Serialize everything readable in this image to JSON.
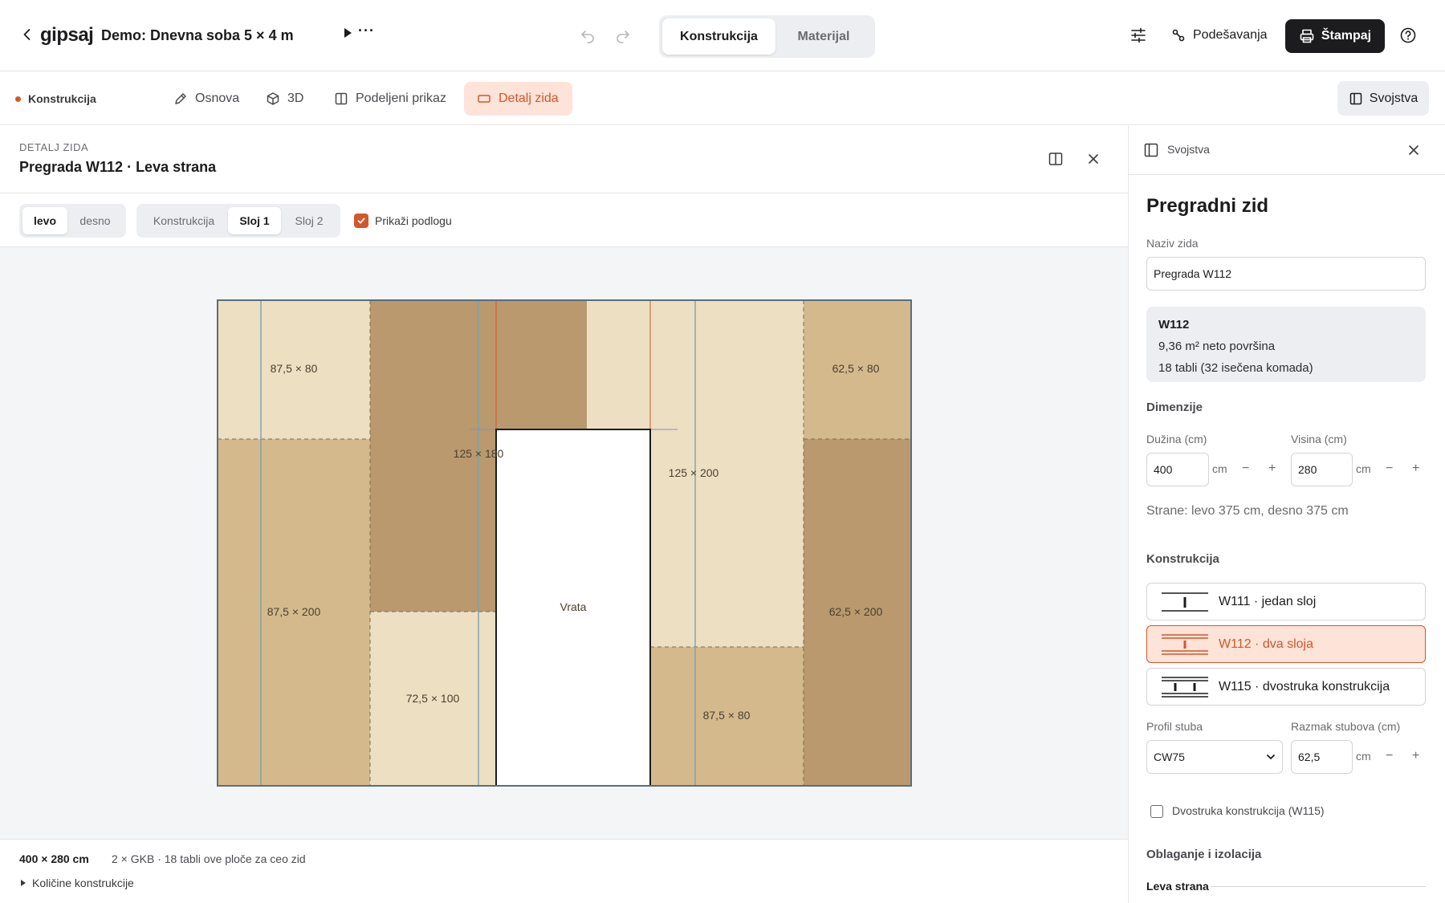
{
  "app": {
    "logo": "gipsaj",
    "project_title": "Demo: Dnevna soba 5 × 4 m",
    "more": "···"
  },
  "modes": [
    {
      "label": "Konstrukcija",
      "active": true
    },
    {
      "label": "Materijal",
      "active": false
    }
  ],
  "header_actions": {
    "settings_label": "Podešavanja",
    "print_label": "Štampaj"
  },
  "subbar": {
    "crumb": "Konstrukcija",
    "tabs": [
      {
        "label": "Osnova",
        "icon": "pen-icon"
      },
      {
        "label": "3D",
        "icon": "cube-icon"
      },
      {
        "label": "Podeljeni prikaz",
        "icon": "split-icon"
      },
      {
        "label": "Detalj zida",
        "icon": "wall-icon",
        "active": true
      }
    ],
    "properties_button": "Svojstva"
  },
  "detail": {
    "kicker": "DETALJ ZIDA",
    "title": "Pregrada W112 · Leva strana",
    "side_toggle": [
      {
        "label": "levo",
        "active": true
      },
      {
        "label": "desno",
        "active": false
      }
    ],
    "layer_toggle": [
      {
        "label": "Konstrukcija",
        "active": false
      },
      {
        "label": "Sloj 1",
        "active": true
      },
      {
        "label": "Sloj 2",
        "active": false
      }
    ],
    "show_base_label": "Prikaži podlogu",
    "show_base_checked": true
  },
  "wall": {
    "panels": [
      {
        "label": "87,5 × 80"
      },
      {
        "label": "87,5 × 200"
      },
      {
        "label": "125 × 180"
      },
      {
        "label": "72,5 × 100"
      },
      {
        "label": "125 × 200"
      },
      {
        "label": "87,5 × 80"
      },
      {
        "label": "62,5 × 80"
      },
      {
        "label": "62,5 × 200"
      }
    ],
    "door_label": "Vrata",
    "colors": {
      "light": "#ecdfc2",
      "mid": "#d4b98c",
      "dark": "#b9996d",
      "stud": "#7aa2b4",
      "outline": "#5b6e7a"
    }
  },
  "footer": {
    "dims": "400 × 280 cm",
    "spec": "2 × GKB · 18 tabli ove ploče za ceo zid",
    "quantities_label": "Količine konstrukcije"
  },
  "properties": {
    "header": "Svojstva",
    "title": "Pregradni zid",
    "name_label": "Naziv zida",
    "name_value": "Pregrada W112",
    "info": {
      "code": "W112",
      "area": "9,36 m² neto površina",
      "boards": "18 tabli (32 isečena komada)"
    },
    "dimensions_title": "Dimenzije",
    "length_label": "Dužina (cm)",
    "length_value": "400",
    "height_label": "Visina (cm)",
    "height_value": "280",
    "unit": "cm",
    "minus": "−",
    "plus": "+",
    "sides_note": "Strane: levo 375 cm, desno 375 cm",
    "construction_title": "Konstrukcija",
    "construction_options": [
      {
        "label": "W111 · jedan sloj",
        "active": false
      },
      {
        "label": "W112 · dva sloja",
        "active": true
      },
      {
        "label": "W115 · dvostruka konstrukcija",
        "active": false
      }
    ],
    "profile_label": "Profil stuba",
    "profile_value": "CW75",
    "spacing_label": "Razmak stubova (cm)",
    "spacing_value": "62,5",
    "double_label": "Dvostruka konstrukcija (W115)",
    "cladding_title": "Oblaganje i izolacija",
    "left_side": "Leva strana"
  }
}
